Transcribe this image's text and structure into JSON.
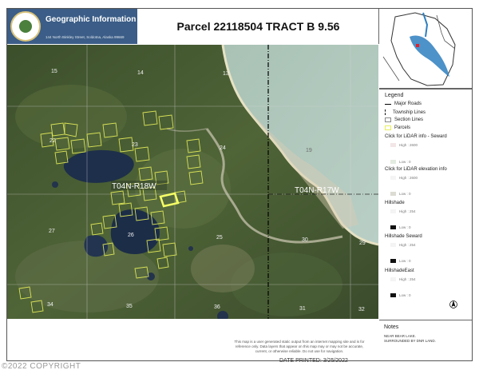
{
  "header": {
    "org_name": "Geographic Information Systems",
    "org_address": "144 North Binkley Street, Soldotna, Alaska 99669",
    "title": "Parcel 22118504 TRACT B 9.56"
  },
  "map": {
    "section_numbers": [
      "15",
      "14",
      "13",
      "22",
      "23",
      "24",
      "19",
      "27",
      "26",
      "25",
      "30",
      "29",
      "34",
      "35",
      "36",
      "31",
      "32"
    ],
    "township_labels": [
      "T04N-R18W",
      "T04N-R17W"
    ]
  },
  "legend": {
    "title": "Legend",
    "items": [
      {
        "label": "Major Roads",
        "color": "#000000"
      },
      {
        "label": "Township Lines",
        "color": "#000000"
      },
      {
        "label": "Section Lines",
        "color": "#888888"
      },
      {
        "label": "Parcels",
        "color": "#e8f05a"
      }
    ],
    "lidar_seward": {
      "label": "Click for LiDAR info - Seward",
      "high": "High : 2600",
      "low": "Low : 0"
    },
    "lidar_elev": {
      "label": "Click for LiDAR elevation info",
      "high": "High : 2600",
      "low": "Low : 0"
    },
    "hillshade": {
      "label": "Hillshade",
      "high": "High : 254",
      "low": "Low : 0"
    },
    "hillshade_seward": {
      "label": "Hillshade Seward",
      "high": "High : 254",
      "low": "Low : 0"
    },
    "hillshade_east": {
      "label": "HillshadeEast",
      "high": "High : 254",
      "low": "Low : 0"
    }
  },
  "notes": {
    "title": "Notes",
    "text_1": "NEAR BEAR LAKE.",
    "text_2": "SURROUNDED BY DNR LAND."
  },
  "footer": {
    "disclaimer_1": "This map is a user generated static output from an internet mapping site and is for",
    "disclaimer_2": "reference only. Data layers that appear on this map may or may not be accurate,",
    "disclaimer_3": "current, or otherwise reliable. Do not use for navigation.",
    "date_printed": "DATE PRINTED: 3/25/2022",
    "copyright": "©2022 COPYRIGHT"
  }
}
